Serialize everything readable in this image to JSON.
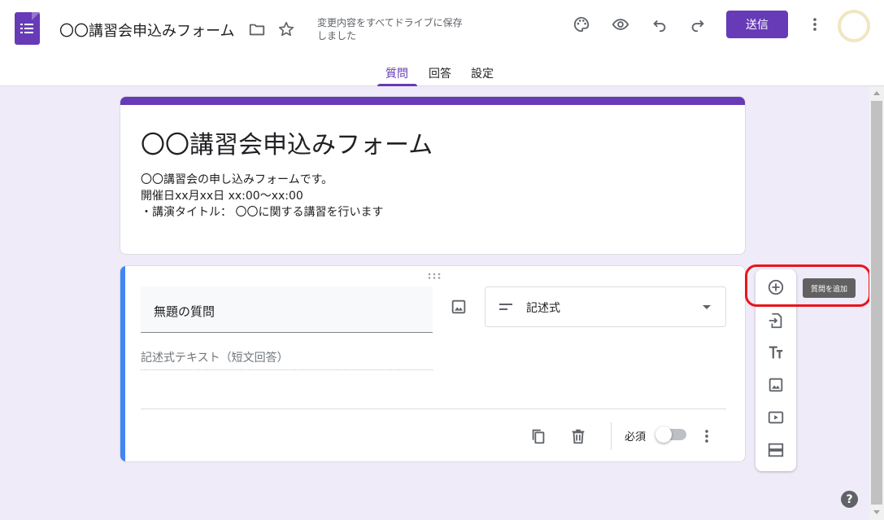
{
  "header": {
    "doc_title": "〇〇講習会申込みフォーム",
    "save_status": "変更内容をすべてドライブに保存しました",
    "send_label": "送信",
    "icons": [
      "folder-icon",
      "star-icon",
      "palette-icon",
      "eye-icon",
      "undo-icon",
      "redo-icon",
      "more-vert-icon"
    ]
  },
  "tabs": [
    {
      "label": "質問",
      "active": true
    },
    {
      "label": "回答",
      "active": false
    },
    {
      "label": "設定",
      "active": false
    }
  ],
  "form": {
    "title": "〇〇講習会申込みフォーム",
    "description": [
      "〇〇講習会の申し込みフォームです。",
      "開催日xx月xx日 xx:00〜xx:00",
      "・講演タイトル： 〇〇に関する講習を行います"
    ]
  },
  "question": {
    "title": "無題の質問",
    "type": "記述式",
    "answer_hint": "記述式テキスト（短文回答）",
    "required_label": "必須",
    "required": false
  },
  "toolbar": {
    "tooltip": "質問を追加",
    "items": [
      "add-question",
      "import-questions",
      "add-title",
      "add-image",
      "add-video",
      "add-section"
    ]
  },
  "colors": {
    "brand": "#673ab7",
    "accent_blue": "#4285f4",
    "highlight_red": "#e8151b",
    "background": "#f0ebf8"
  },
  "help_label": "?"
}
